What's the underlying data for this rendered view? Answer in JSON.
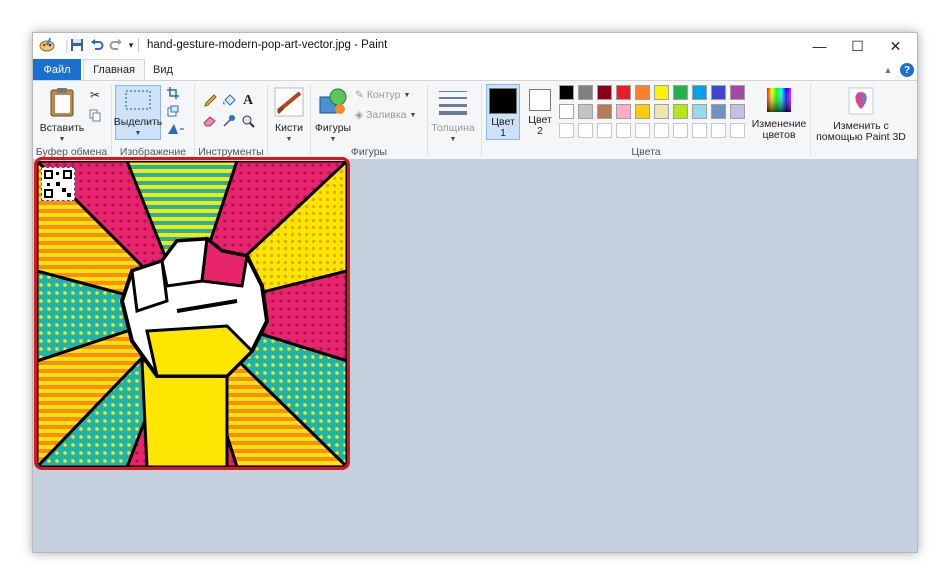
{
  "window": {
    "title": "hand-gesture-modern-pop-art-vector.jpg - Paint"
  },
  "quick_access": [
    "paint-app-icon",
    "save-icon",
    "undo-icon",
    "redo-icon",
    "customize-qa-icon"
  ],
  "tabs": {
    "file": "Файл",
    "home": "Главная",
    "view": "Вид"
  },
  "ribbon": {
    "clipboard": {
      "paste": "Вставить",
      "group_label": "Буфер обмена"
    },
    "image": {
      "select": "Выделить",
      "group_label": "Изображение"
    },
    "tools": {
      "group_label": "Инструменты"
    },
    "brushes": {
      "label": "Кисти"
    },
    "shapes": {
      "label": "Фигуры",
      "outline": "Контур",
      "fill": "Заливка",
      "group_label": "Фигуры"
    },
    "thickness": {
      "label": "Толщина"
    },
    "colors": {
      "color1_line1": "Цвет",
      "color1_line2": "1",
      "color2_line1": "Цвет",
      "color2_line2": "2",
      "edit_line1": "Изменение",
      "edit_line2": "цветов",
      "group_label": "Цвета",
      "palette_row1": [
        "#000000",
        "#7f7f7f",
        "#880015",
        "#ed1c24",
        "#ff7f27",
        "#fff200",
        "#22b14c",
        "#00a2e8",
        "#3f48cc",
        "#a349a4"
      ],
      "palette_row2": [
        "#ffffff",
        "#c3c3c3",
        "#b97a57",
        "#ffaec9",
        "#ffc90e",
        "#efe4b0",
        "#b5e61d",
        "#99d9ea",
        "#7092be",
        "#c8bfe7"
      ]
    },
    "paint3d": {
      "line1": "Изменить с",
      "line2": "помощью Paint 3D"
    }
  },
  "accent": {
    "file_tab": "#1a6fd1",
    "highlight": "#d7161e",
    "workspace": "#c5d0de"
  }
}
